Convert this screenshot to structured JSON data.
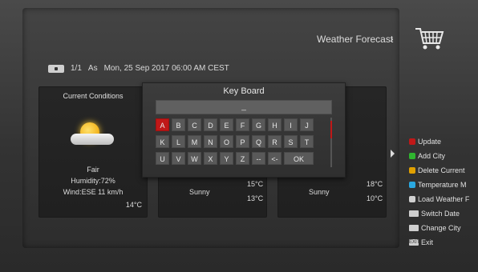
{
  "header": {
    "title": "Weather Forecast",
    "chevron": "›"
  },
  "info": {
    "page": "1/1",
    "location": "As",
    "datetime": "Mon, 25 Sep 2017 06:00 AM CEST"
  },
  "current": {
    "title": "Current Conditions",
    "condition": "Fair",
    "humidity": "Humidity:72%",
    "wind": "Wind:ESE 11 km/h",
    "temp": "14°C"
  },
  "day2": {
    "condition": "Sunny",
    "temp_high": "15°C",
    "temp_low": "13°C"
  },
  "day3": {
    "condition": "Sunny",
    "temp_high": "18°C",
    "temp_low": "10°C"
  },
  "keyboard": {
    "title": "Key Board",
    "input_value": "_",
    "rows": [
      [
        "A",
        "B",
        "C",
        "D",
        "E",
        "F",
        "G",
        "H",
        "I",
        "J"
      ],
      [
        "K",
        "L",
        "M",
        "N",
        "O",
        "P",
        "Q",
        "R",
        "S",
        "T"
      ],
      [
        "U",
        "V",
        "W",
        "X",
        "Y",
        "Z",
        "--",
        "<-",
        "OK"
      ]
    ]
  },
  "menu": [
    {
      "label": "Update",
      "color": "#c01818"
    },
    {
      "label": "Add City",
      "color": "#2fb52f"
    },
    {
      "label": "Delete Current",
      "color": "#e0a000"
    },
    {
      "label": "Temperature M",
      "color": "#2aa8e0"
    },
    {
      "label": "Load Weather F",
      "color": "#d0d0d0"
    },
    {
      "label": "Switch Date",
      "type": "btn"
    },
    {
      "label": "Change City",
      "type": "btn"
    },
    {
      "label": "Exit",
      "type": "exit",
      "tag": "EXIT"
    }
  ]
}
